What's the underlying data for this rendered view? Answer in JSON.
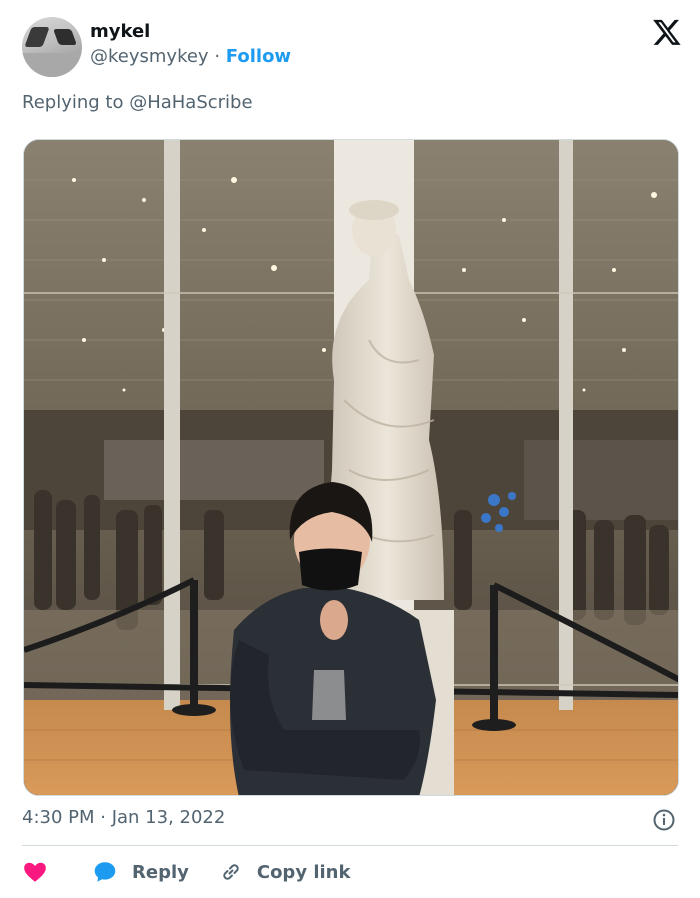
{
  "author": {
    "display_name": "mykel",
    "handle": "@keysmykey",
    "separator": "·",
    "follow_label": "Follow"
  },
  "reply_to": "Replying to @HaHaScribe",
  "media": {
    "icon": "photo"
  },
  "timestamp": "4:30 PM · Jan 13, 2022",
  "actions": {
    "like_icon": "heart-icon",
    "reply_label": "Reply",
    "copy_link_label": "Copy link"
  },
  "colors": {
    "accent": "#1d9bf0",
    "heart": "#f91880",
    "secondary_text": "#536471"
  }
}
